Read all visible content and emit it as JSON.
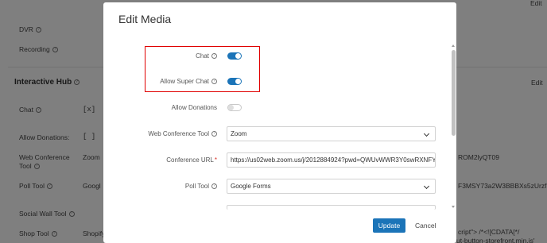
{
  "background": {
    "top_edit": "Edit",
    "dvr_label": "DVR",
    "recording_label": "Recording",
    "interactive_hub_title": "Interactive Hub",
    "interactive_hub_edit": "Edit",
    "chat_label": "Chat",
    "chat_value": "[x]",
    "allow_donations_label": "Allow Donations:",
    "allow_donations_value": "[ ]",
    "web_conference_label_line1": "Web Conference",
    "web_conference_label_line2": "Tool",
    "web_conference_value": "Zoom",
    "url_right_fragment": "ROM2lyQT09",
    "poll_tool_label": "Poll Tool",
    "poll_tool_value": "Googl",
    "poll_right_fragment": "F3MSY73a2W3BBBXs5zUrzf5-",
    "social_wall_label": "Social Wall Tool",
    "shop_tool_label": "Shop Tool",
    "shop_tool_value": "Shopify",
    "shop_right_fragment": "cript\"> /*<![CDATA[*/",
    "bottom_fragment": "ut-button-storefront.min.js'"
  },
  "modal": {
    "title": "Edit Media",
    "rows": {
      "chat_label": "Chat",
      "chat_on": true,
      "allow_super_chat_label": "Allow Super Chat",
      "allow_super_chat_on": true,
      "allow_donations_label": "Allow Donations",
      "allow_donations_on": false,
      "web_conference_tool_label": "Web Conference Tool",
      "web_conference_tool_value": "Zoom",
      "conference_url_label": "Conference URL",
      "conference_url_required": "*",
      "conference_url_value": "https://us02web.zoom.us/j/2012884924?pwd=QWUvWWR3Y0swRXNFY",
      "poll_tool_label": "Poll Tool",
      "poll_tool_value": "Google Forms"
    },
    "update_label": "Update",
    "cancel_label": "Cancel"
  },
  "colors": {
    "accent": "#1b74b8",
    "highlight": "#e00000"
  }
}
